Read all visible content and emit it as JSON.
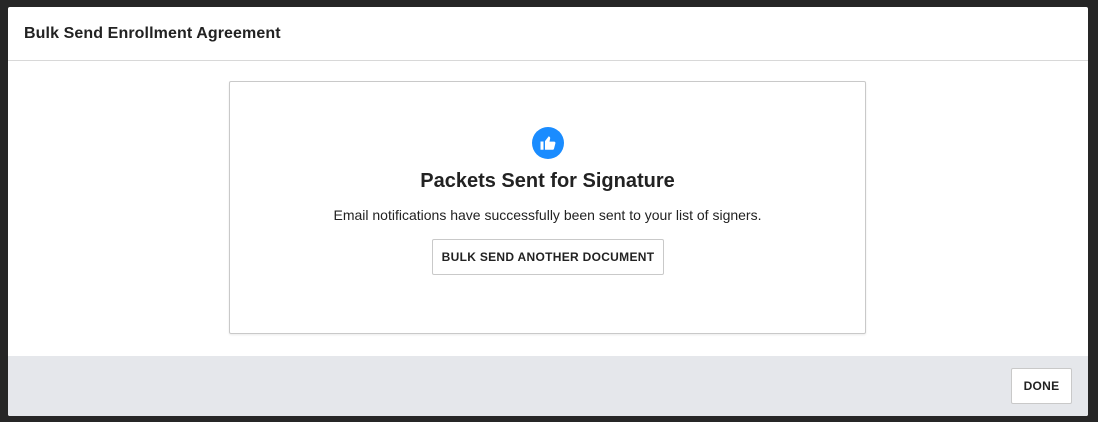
{
  "modal": {
    "title": "Bulk Send Enrollment Agreement"
  },
  "success_card": {
    "icon": "thumbs-up-icon",
    "icon_color": "#1a8cff",
    "title": "Packets Sent for Signature",
    "message": "Email notifications have successfully been sent to your list of signers.",
    "bulk_send_button_label": "BULK SEND ANOTHER DOCUMENT"
  },
  "footer": {
    "done_button_label": "DONE",
    "background_color": "#e5e7eb"
  }
}
